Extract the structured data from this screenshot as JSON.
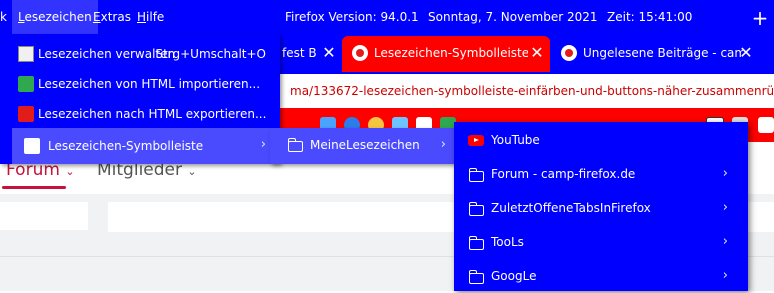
{
  "menubar": {
    "items": [
      "k",
      "Lesezeichen",
      "Extras",
      "Hilfe"
    ],
    "version": "Firefox Version: 94.0.1",
    "date": "Sonntag, 7. November 2021",
    "time": "Zeit:  15:41:00"
  },
  "tabs": [
    {
      "title": "fest B"
    },
    {
      "title": "Lesezeichen-Symbolleiste ein"
    },
    {
      "title": "Ungelesene Beiträge - camp"
    }
  ],
  "url": "ma/133672-lesezeichen-symbolleiste-einfärben-und-buttons-näher-zusammenrü",
  "site_nav": {
    "forum": "Forum",
    "members": "Mitglieder"
  },
  "bookmarks_menu": {
    "items": [
      {
        "label": "Lesezeichen verwalten",
        "shortcut": "Strg+Umschalt+O"
      },
      {
        "label": "Lesezeichen von HTML importieren..."
      },
      {
        "label": "Lesezeichen nach HTML exportieren..."
      },
      {
        "label": "Lesezeichen-Symbolleiste"
      }
    ]
  },
  "toolbar_submenu": {
    "folder": "MeineLesezeichen"
  },
  "folder_submenu": {
    "items": [
      {
        "label": "YouTube"
      },
      {
        "label": "Forum - camp-firefox.de"
      },
      {
        "label": "ZuletztOffeneTabsInFirefox"
      },
      {
        "label": "TooLs"
      },
      {
        "label": "GoogLe"
      }
    ]
  },
  "colors": {
    "menubar_bg": "#0000ff",
    "selected_tab": "#ff0000",
    "bookmarks_toolbar": "#ff0000",
    "menu_highlight": "#4a4aff",
    "url_text": "#cc0000",
    "site_accent": "#c4113d"
  }
}
